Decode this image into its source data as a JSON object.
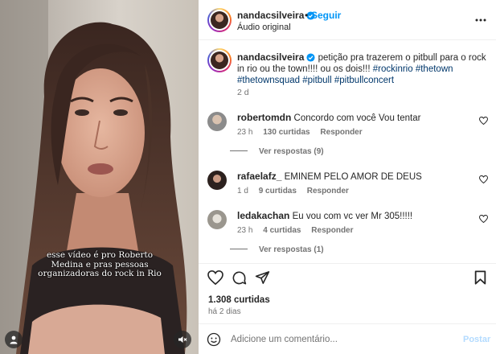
{
  "video": {
    "subtitle": "esse vídeo é pro Roberto Medina e pras pessoas organizadoras do rock in Rio",
    "user_icon": "person-icon",
    "mute_icon": "speaker-muted-icon"
  },
  "header": {
    "username": "nandacsilveira",
    "separator": "•",
    "follow_label": "Seguir",
    "audio_label": "Áudio original",
    "more_icon": "more-horizontal-icon"
  },
  "caption": {
    "username": "nandacsilveira",
    "text": "petição pra trazerem o pitbull para o rock in rio ou the town!!!! ou os dois!!!",
    "hashtags": [
      "#rockinrio",
      "#thetown",
      "#thetownsquad",
      "#pitbull",
      "#pitbullconcert"
    ],
    "time": "2 d"
  },
  "comments": [
    {
      "username": "robertomdn",
      "text": "Concordo com você Vou tentar",
      "time": "23 h",
      "likes": "130 curtidas",
      "reply_label": "Responder",
      "view_replies": "Ver respostas (9)"
    },
    {
      "username": "rafaelafz_",
      "text": "EMINEM PELO AMOR DE DEUS",
      "time": "1 d",
      "likes": "9 curtidas",
      "reply_label": "Responder",
      "view_replies": ""
    },
    {
      "username": "ledakachan",
      "text": "Eu vou com vc ver Mr 305!!!!!",
      "time": "23 h",
      "likes": "4 curtidas",
      "reply_label": "Responder",
      "view_replies": "Ver respostas (1)"
    }
  ],
  "actions": {
    "icons": [
      "heart-icon",
      "comment-icon",
      "share-icon",
      "bookmark-icon"
    ],
    "likes": "1.308 curtidas",
    "posted": "há 2 dias"
  },
  "composer": {
    "placeholder": "Adicione um comentário...",
    "post_label": "Postar"
  },
  "colors": {
    "accent": "#0095f6",
    "link": "#00376b",
    "muted": "#737373",
    "post_disabled": "#b3dbff"
  }
}
